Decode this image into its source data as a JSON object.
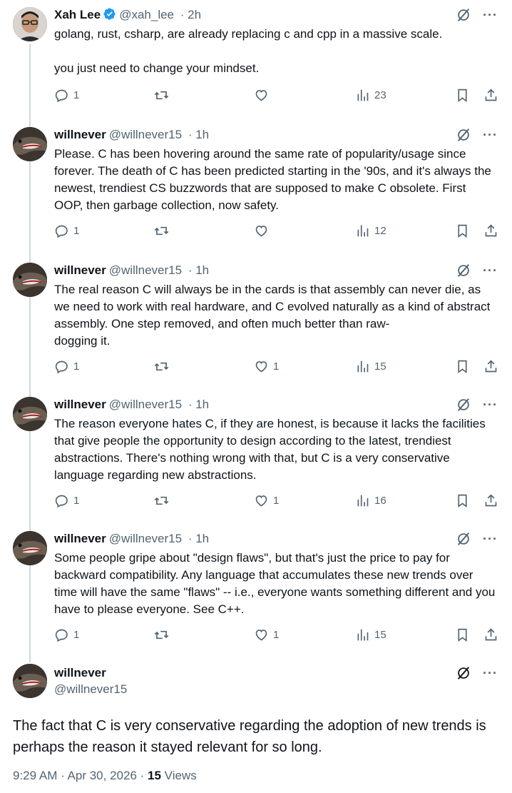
{
  "tweets": [
    {
      "name": "Xah Lee",
      "verified": true,
      "handle": "@xah_lee",
      "time": "· 2h",
      "text": "golang, rust, csharp, are already replacing c and cpp in a massive scale.\n\nyou just need to change your mindset.",
      "replies": "1",
      "retweets": "",
      "likes": "",
      "views": "23",
      "avatar": "man-with-glasses"
    },
    {
      "name": "willnever",
      "verified": false,
      "handle": "@willnever15",
      "time": "· 1h",
      "text": "Please. C has been hovering around the same rate of popularity/usage since forever. The death of C has been predicted starting in the '90s, and it's always the newest, trendiest CS buzzwords that are supposed to make C obsolete. First OOP, then garbage collection, now safety.",
      "replies": "1",
      "retweets": "",
      "likes": "",
      "views": "12",
      "avatar": "lizard"
    },
    {
      "name": "willnever",
      "verified": false,
      "handle": "@willnever15",
      "time": "· 1h",
      "text": "The real reason C will always be in the cards is that assembly can never die, as we need to work with real hardware, and C evolved naturally as a kind of abstract assembly. One step removed, and often much better than raw-\ndogging it.",
      "replies": "1",
      "retweets": "",
      "likes": "1",
      "views": "15",
      "avatar": "lizard"
    },
    {
      "name": "willnever",
      "verified": false,
      "handle": "@willnever15",
      "time": "· 1h",
      "text": "The reason everyone hates C, if they are honest, is because it lacks the facilities that give people the opportunity to design according to the latest, trendiest abstractions. There's nothing wrong with that, but C is a very conservative language regarding new abstractions.",
      "replies": "1",
      "retweets": "",
      "likes": "1",
      "views": "16",
      "avatar": "lizard"
    },
    {
      "name": "willnever",
      "verified": false,
      "handle": "@willnever15",
      "time": "· 1h",
      "text": "Some people gripe about \"design flaws\", but that's just the price to pay for backward compatibility. Any language that accumulates these new trends over time will have the same \"flaws\" -- i.e., everyone wants something different and you have to please everyone. See C++.",
      "replies": "1",
      "retweets": "",
      "likes": "1",
      "views": "15",
      "avatar": "lizard"
    }
  ],
  "main_tweet": {
    "name": "willnever",
    "handle": "@willnever15",
    "text": "The fact that C is very conservative regarding the adoption of new trends is perhaps the reason it stayed relevant for so long.",
    "timestamp": "9:29 AM · Apr 30, 2026 · ",
    "views_count": "15",
    "views_label": " Views"
  },
  "colors": {
    "text": "#0f1419",
    "secondary": "#536471",
    "verified": "#1d9bf0",
    "thread_line": "#cfd9de"
  },
  "icons": {
    "reply": "speech-bubble-icon",
    "retweet": "retweet-icon",
    "like": "heart-icon",
    "views": "bar-chart-icon",
    "bookmark": "bookmark-icon",
    "share": "share-icon",
    "grok": "grok-icon",
    "more": "more-dots-icon"
  }
}
